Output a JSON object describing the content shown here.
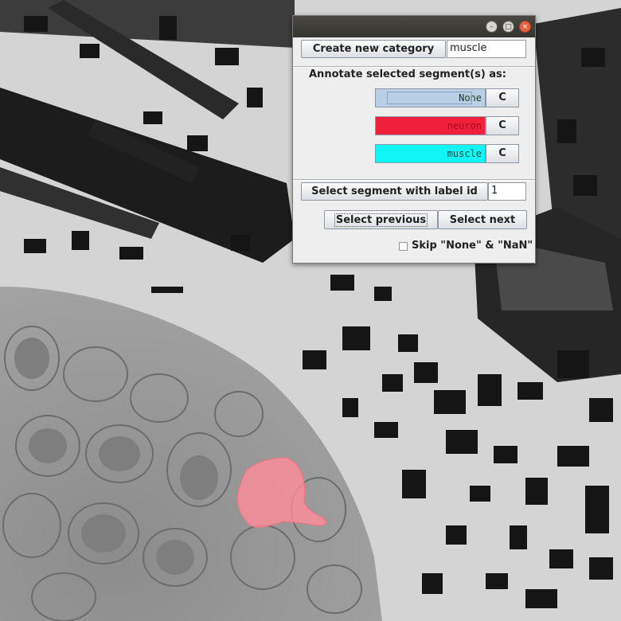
{
  "dialog": {
    "create_button_label": "Create new category",
    "category_name_value": "muscle",
    "annotate_label": "Annotate selected segment(s) as:",
    "categories": [
      {
        "label": "None",
        "color": "#b8cfe5",
        "text_color": "#1a3d1a",
        "clear_label": "C"
      },
      {
        "label": "neuron",
        "color": "#f01f3c",
        "text_color": "#a50d20",
        "clear_label": "C"
      },
      {
        "label": "muscle",
        "color": "#10f5f5",
        "text_color": "#1a4a4a",
        "clear_label": "C"
      }
    ],
    "select_label_button": "Select segment with label id",
    "label_id_value": "1",
    "select_previous": "Select previous",
    "select_next": "Select next",
    "skip_checkbox_label": "Skip \"None\" & \"NaN\"",
    "skip_checked": false
  },
  "overlay": {
    "highlight_color": "#ff8c9a"
  }
}
